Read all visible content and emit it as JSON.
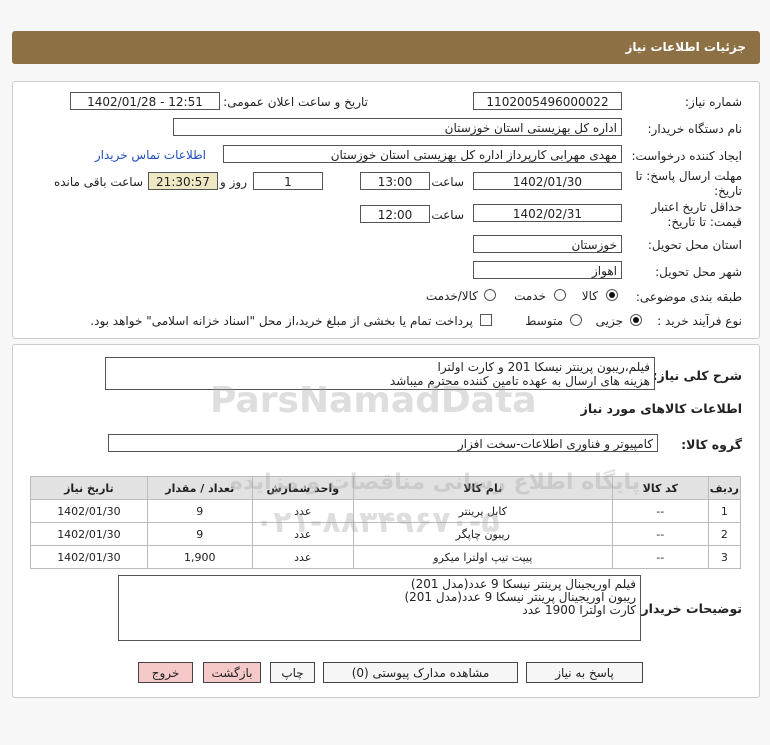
{
  "header": {
    "title": "جزئیات اطلاعات نیاز"
  },
  "form": {
    "need_number_label": "شماره نیاز:",
    "need_number": "1102005496000022",
    "announce_label": "تاریخ و ساعت اعلان عمومی:",
    "announce_value": "1402/01/28 - 12:51",
    "buyer_label": "نام دستگاه خریدار:",
    "buyer_value": "اداره کل بهزیستی استان خوزستان",
    "requester_label": "ایجاد کننده درخواست:",
    "requester_value": "مهدی مهرابی کارپرداز اداره کل بهزیستی استان خوزستان",
    "contact_link": "اطلاعات تماس خریدار",
    "deadline_label_1": "مهلت ارسال پاسخ: تا",
    "deadline_label_2": "تاریخ:",
    "deadline_date": "1402/01/30",
    "time_label": "ساعت",
    "deadline_time": "13:00",
    "days_value": "1",
    "days_label": "روز و",
    "remaining_value": "21:30:57",
    "remaining_label": "ساعت باقی مانده",
    "validity_label_1": "حداقل تاریخ اعتبار",
    "validity_label_2": "قیمت: تا تاریخ:",
    "validity_date": "1402/02/31",
    "validity_time": "12:00",
    "province_label": "استان محل تحویل:",
    "province_value": "خوزستان",
    "city_label": "شهر محل تحویل:",
    "city_value": "اهواز",
    "category_label": "طبقه بندی موضوعی:",
    "category_options": [
      "کالا",
      "خدمت",
      "کالا/خدمت"
    ],
    "category_selected": "کالا",
    "process_label": "نوع فرآیند خرید :",
    "process_options": [
      "جزیی",
      "متوسط"
    ],
    "process_selected": "جزیی",
    "payment_note": "پرداخت تمام یا بخشی از مبلغ خرید،از محل \"اسناد خزانه اسلامی\" خواهد بود."
  },
  "summary": {
    "label": "شرح کلی نیاز:",
    "line1": "فیلم،ریبون پرینتر  نیسکا 201 و کارت اولترا",
    "line2": "هزینه های ارسال به عهده تامین کننده محترم میباشد"
  },
  "goods": {
    "section_title": "اطلاعات کالاهای مورد نیاز",
    "group_label": "گروه کالا:",
    "group_value": "کامپیوتر و فناوری اطلاعات-سخت افزار",
    "columns": [
      "ردیف",
      "کد کالا",
      "نام کالا",
      "واحد شمارش",
      "تعداد / مقدار",
      "تاریخ نیاز"
    ],
    "rows": [
      [
        "1",
        "--",
        "کابل پرینتر",
        "عدد",
        "9",
        "1402/01/30"
      ],
      [
        "2",
        "--",
        "ریبون چاپگر",
        "عدد",
        "9",
        "1402/01/30"
      ],
      [
        "3",
        "--",
        "پیپت تیپ اولترا میکرو",
        "عدد",
        "1,900",
        "1402/01/30"
      ]
    ]
  },
  "buyer_notes": {
    "label": "توضیحات خریدار:",
    "line1": "فیلم اوریجینال پرینتر نیسکا 9 عدد(مدل 201)",
    "line2": "ریبون اوریجینال پرینتر نیسکا 9 عدد(مدل 201)",
    "line3": "کارت اولترا 1900 عدد"
  },
  "buttons": {
    "reply": "پاسخ به نیاز",
    "attachments": "مشاهده مدارک پیوستی (0)",
    "print": "چاپ",
    "back": "بازگشت",
    "exit": "خروج"
  },
  "watermark": {
    "brand": "ParsNamadData",
    "tagline": "پایگاه اطلاع رسانی مناقصات و مزایده",
    "phone": "۰۲۱-۸۸۳۴۹۶۷۰-۵"
  },
  "colors": {
    "header_bg": "#8e7045",
    "link": "#1f4fbf",
    "remaining_bg": "#efe8c4",
    "exit_btn": "#f6c9c9"
  }
}
